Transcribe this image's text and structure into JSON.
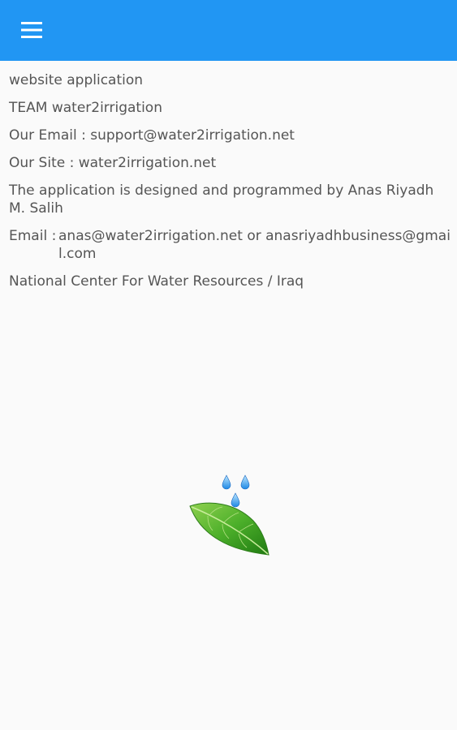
{
  "appbar": {
    "menu_icon": "hamburger-menu-icon",
    "color": "#2196f3"
  },
  "content": {
    "line1": "website application",
    "line2": "TEAM water2irrigation",
    "line3": "Our Email :  support@water2irrigation.net",
    "line4": "Our Site :  water2irrigation.net",
    "line5": "The application is designed and programmed by Anas Riyadh M. Salih",
    "email_label": "Email :",
    "email_value": "anas@water2irrigation.net or anasriyadhbusiness@gmail.com",
    "line7": "National Center For Water Resources / Iraq"
  },
  "logo": {
    "icon": "leaf-with-water-drops-icon"
  }
}
